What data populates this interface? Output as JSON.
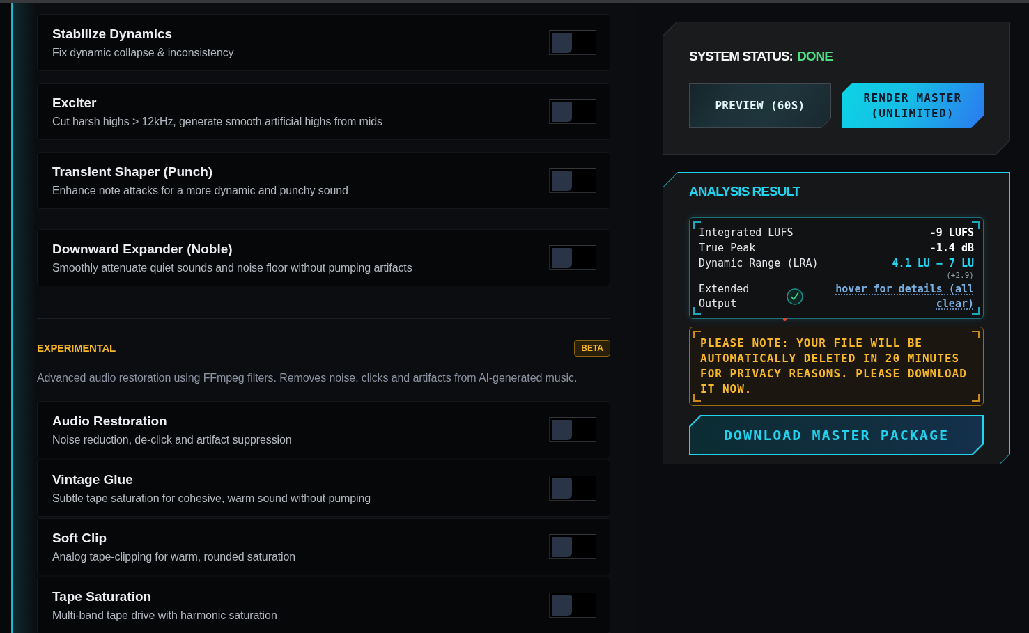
{
  "effects": [
    {
      "title": "Stabilize Dynamics",
      "description": "Fix dynamic collapse & inconsistency",
      "on": false
    },
    {
      "title": "Exciter",
      "description": "Cut harsh highs > 12kHz, generate smooth artificial highs from mids",
      "on": false
    },
    {
      "title": "Transient Shaper (Punch)",
      "description": "Enhance note attacks for a more dynamic and punchy sound",
      "on": false
    },
    {
      "title": "Downward Expander (Noble)",
      "description": "Smoothly attenuate quiet sounds and noise floor without pumping artifacts",
      "on": false
    }
  ],
  "experimental": {
    "title": "EXPERIMENTAL",
    "badge": "BETA",
    "description": "Advanced audio restoration using FFmpeg filters. Removes noise, clicks and artifacts from AI-generated music.",
    "effects": [
      {
        "title": "Audio Restoration",
        "description": "Noise reduction, de-click and artifact suppression",
        "on": false
      },
      {
        "title": "Vintage Glue",
        "description": "Subtle tape saturation for cohesive, warm sound without pumping",
        "on": false
      },
      {
        "title": "Soft Clip",
        "description": "Analog tape-clipping for warm, rounded saturation",
        "on": false
      },
      {
        "title": "Tape Saturation",
        "description": "Multi-band tape drive with harmonic saturation",
        "on": false
      }
    ]
  },
  "status": {
    "label": "SYSTEM STATUS:",
    "value": "DONE",
    "buttons": [
      {
        "label": "PREVIEW (60S)",
        "kind": "secondary"
      },
      {
        "label": "RENDER MASTER (UNLIMITED)",
        "kind": "primary"
      }
    ]
  },
  "analysis": {
    "title": "ANALYSIS RESULT",
    "metrics": [
      {
        "kind": "plain",
        "label": "Integrated LUFS",
        "value": "-9 LUFS"
      },
      {
        "kind": "plain",
        "label": "True Peak",
        "value": "-1.4 dB"
      },
      {
        "kind": "change",
        "label": "Dynamic Range (LRA)",
        "value": "4.1 LU → 7 LU",
        "note": "(+2.9)"
      },
      {
        "kind": "link",
        "label": "Extended Output",
        "value": "hover for details (all clear)",
        "ok": true
      }
    ],
    "notice": "PLEASE NOTE: YOUR FILE WILL BE AUTOMATICALLY DELETED IN 20 MINUTES FOR PRIVACY REASONS. PLEASE DOWNLOAD IT NOW.",
    "download": "DOWNLOAD MASTER PACKAGE"
  }
}
